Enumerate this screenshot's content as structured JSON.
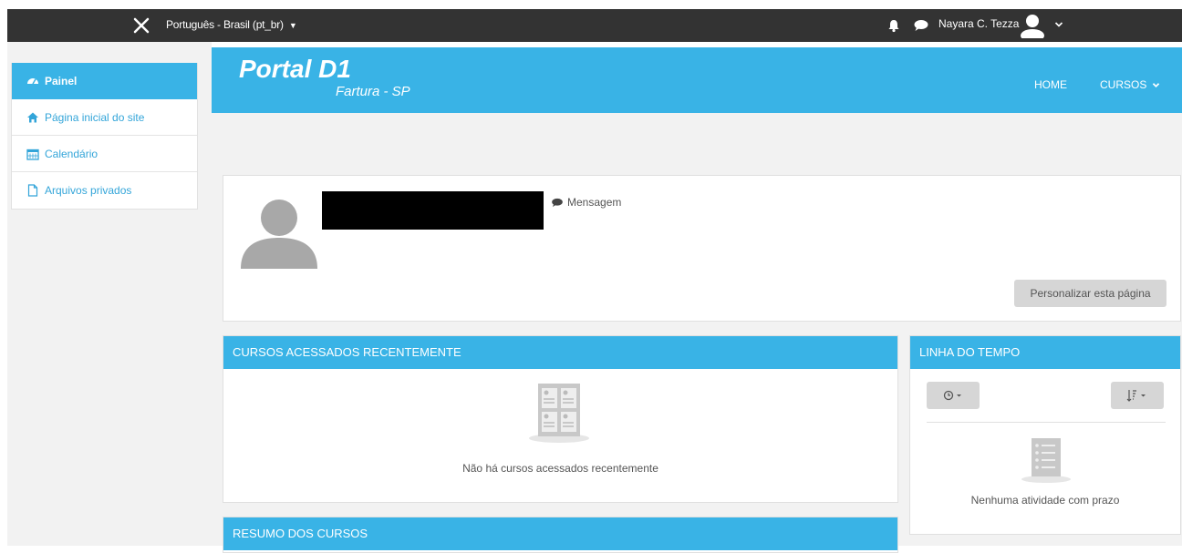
{
  "topbar": {
    "language": "Português - Brasil (pt_br)",
    "user_name": "Nayara C. Tezza"
  },
  "sidebar": {
    "items": [
      {
        "label": "Painel",
        "icon": "dashboard-icon",
        "active": true
      },
      {
        "label": "Página inicial do site",
        "icon": "home-icon",
        "active": false
      },
      {
        "label": "Calendário",
        "icon": "calendar-icon",
        "active": false
      },
      {
        "label": "Arquivos privados",
        "icon": "file-icon",
        "active": false
      }
    ]
  },
  "header": {
    "logo_text": "Portal D1",
    "logo_subtitle": "Fartura - SP",
    "nav_home": "HOME",
    "nav_cursos": "CURSOS"
  },
  "profile": {
    "message_label": "Mensagem",
    "customize_button": "Personalizar esta página"
  },
  "recent_courses": {
    "title": "CURSOS ACESSADOS RECENTEMENTE",
    "empty_text": "Não há cursos acessados recentemente"
  },
  "timeline": {
    "title": "LINHA DO TEMPO",
    "empty_text": "Nenhuma atividade com prazo"
  },
  "course_summary": {
    "title": "RESUMO DOS CURSOS"
  },
  "colors": {
    "accent": "#39b3e6",
    "topbar": "#333333",
    "background": "#f2f2f2"
  }
}
